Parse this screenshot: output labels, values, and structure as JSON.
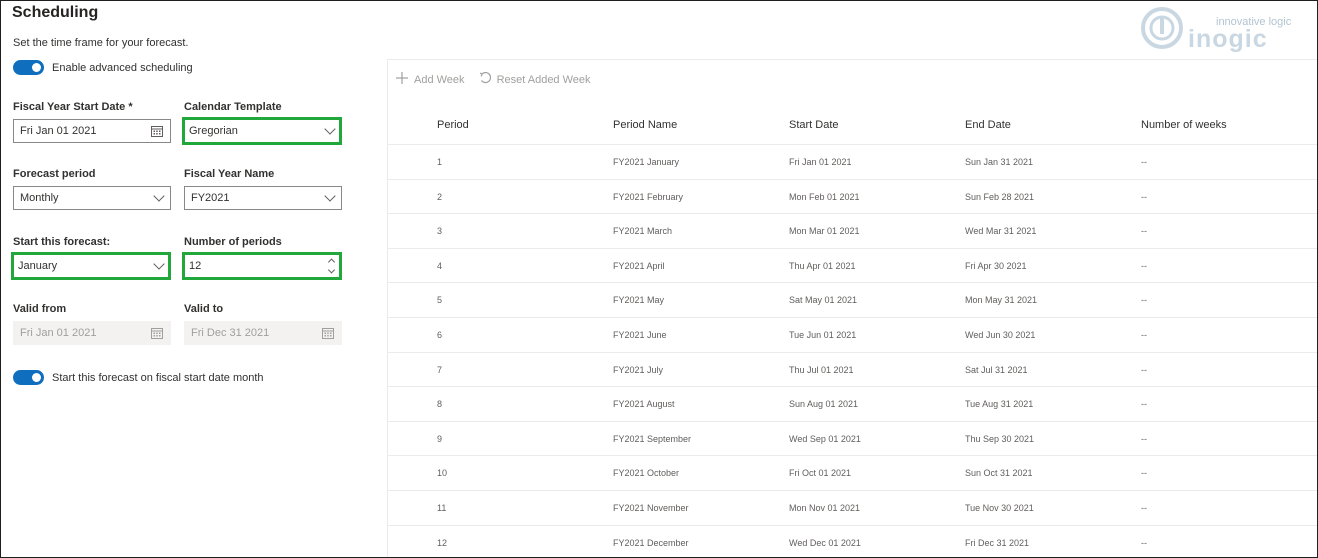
{
  "header": {
    "title": "Scheduling",
    "subtitle": "Set the time frame for your forecast."
  },
  "logo": {
    "tagline": "innovative logic",
    "wordmark": "inogic"
  },
  "toggles": {
    "advanced": "Enable advanced scheduling",
    "fiscal_start": "Start this forecast on fiscal start date month"
  },
  "form": {
    "fiscal_year_start_date": {
      "label": "Fiscal Year Start Date *",
      "value": "Fri Jan 01 2021"
    },
    "calendar_template": {
      "label": "Calendar Template",
      "value": "Gregorian"
    },
    "forecast_period": {
      "label": "Forecast period",
      "value": "Monthly"
    },
    "fiscal_year_name": {
      "label": "Fiscal Year Name",
      "value": "FY2021"
    },
    "start_forecast": {
      "label": "Start this forecast:",
      "value": "January"
    },
    "number_of_periods": {
      "label": "Number of periods",
      "value": "12"
    },
    "valid_from": {
      "label": "Valid from",
      "value": "Fri Jan 01 2021"
    },
    "valid_to": {
      "label": "Valid to",
      "value": "Fri Dec 31 2021"
    }
  },
  "toolbar": {
    "add_week": "Add Week",
    "reset_week": "Reset Added Week"
  },
  "grid": {
    "columns": [
      "Period",
      "Period Name",
      "Start Date",
      "End Date",
      "Number of weeks"
    ],
    "rows": [
      [
        "1",
        "FY2021 January",
        "Fri Jan 01 2021",
        "Sun Jan 31 2021",
        "--"
      ],
      [
        "2",
        "FY2021 February",
        "Mon Feb 01 2021",
        "Sun Feb 28 2021",
        "--"
      ],
      [
        "3",
        "FY2021 March",
        "Mon Mar 01 2021",
        "Wed Mar 31 2021",
        "--"
      ],
      [
        "4",
        "FY2021 April",
        "Thu Apr 01 2021",
        "Fri Apr 30 2021",
        "--"
      ],
      [
        "5",
        "FY2021 May",
        "Sat May 01 2021",
        "Mon May 31 2021",
        "--"
      ],
      [
        "6",
        "FY2021 June",
        "Tue Jun 01 2021",
        "Wed Jun 30 2021",
        "--"
      ],
      [
        "7",
        "FY2021 July",
        "Thu Jul 01 2021",
        "Sat Jul 31 2021",
        "--"
      ],
      [
        "8",
        "FY2021 August",
        "Sun Aug 01 2021",
        "Tue Aug 31 2021",
        "--"
      ],
      [
        "9",
        "FY2021 September",
        "Wed Sep 01 2021",
        "Thu Sep 30 2021",
        "--"
      ],
      [
        "10",
        "FY2021 October",
        "Fri Oct 01 2021",
        "Sun Oct 31 2021",
        "--"
      ],
      [
        "11",
        "FY2021 November",
        "Mon Nov 01 2021",
        "Tue Nov 30 2021",
        "--"
      ],
      [
        "12",
        "FY2021 December",
        "Wed Dec 01 2021",
        "Fri Dec 31 2021",
        "--"
      ]
    ]
  },
  "colors": {
    "accent": "#106ebe",
    "highlight": "#22a83a"
  }
}
